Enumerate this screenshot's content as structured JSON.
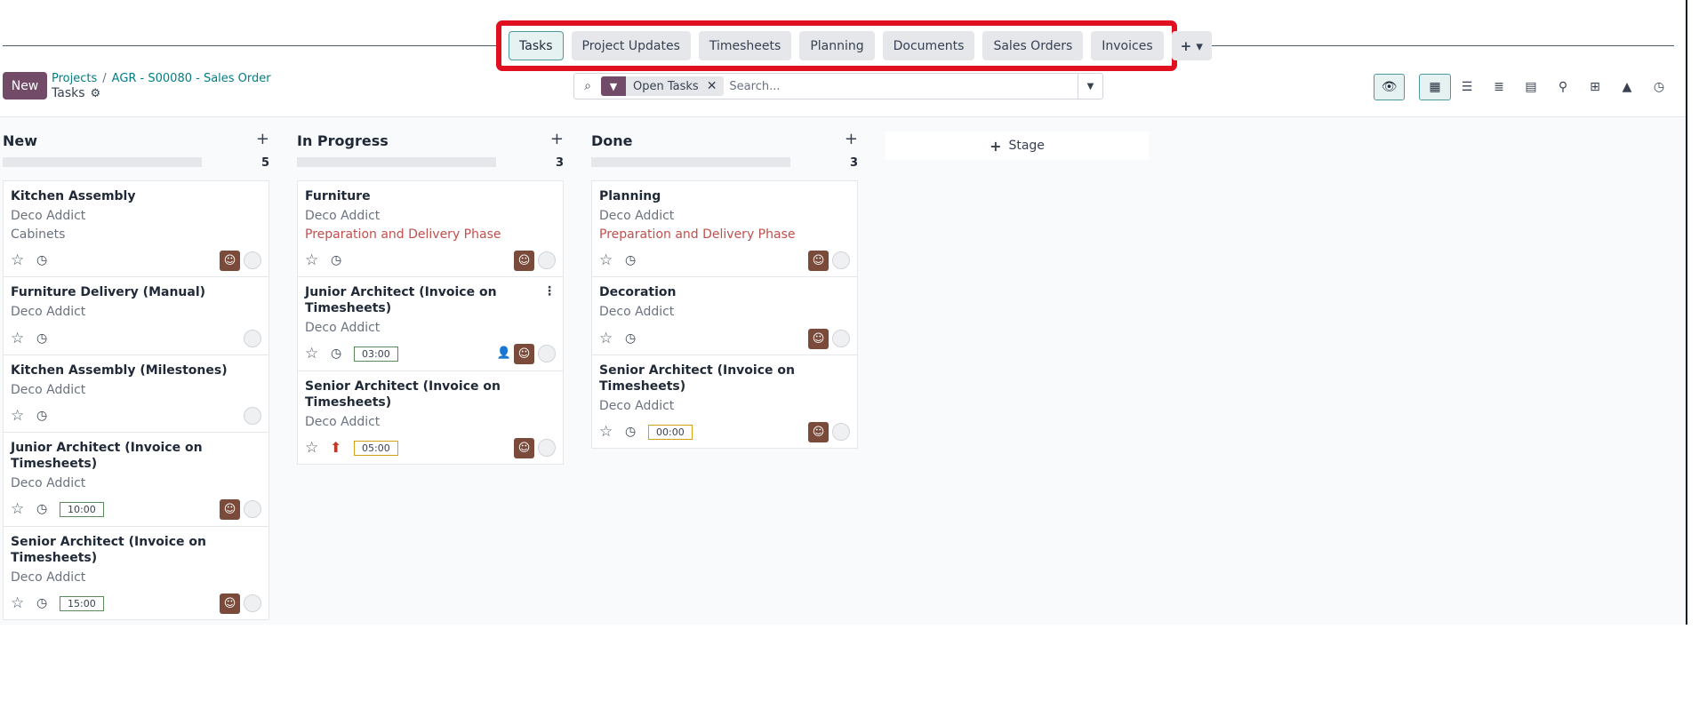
{
  "tabs": [
    {
      "label": "Tasks",
      "active": true
    },
    {
      "label": "Project Updates"
    },
    {
      "label": "Timesheets"
    },
    {
      "label": "Planning"
    },
    {
      "label": "Documents"
    },
    {
      "label": "Sales Orders"
    },
    {
      "label": "Invoices"
    }
  ],
  "tabs_more": "+ ▾",
  "control": {
    "new_label": "New",
    "breadcrumb_root": "Projects",
    "breadcrumb_separator": "/",
    "breadcrumb_project": "AGR - S00080 - Sales Order",
    "subtitle": "Tasks"
  },
  "search": {
    "facet_label": "Open Tasks",
    "placeholder": "Search..."
  },
  "columns": [
    {
      "title": "New",
      "count": "5",
      "cards": [
        {
          "title": "Kitchen Assembly",
          "customer": "Deco Addict",
          "tag": "Cabinets"
        },
        {
          "title": "Furniture Delivery (Manual)",
          "customer": "Deco Addict"
        },
        {
          "title": "Kitchen Assembly (Milestones)",
          "customer": "Deco Addict"
        },
        {
          "title": "Junior Architect (Invoice on Timesheets)",
          "customer": "Deco Addict",
          "hours": "10:00"
        },
        {
          "title": "Senior Architect (Invoice on Timesheets)",
          "customer": "Deco Addict",
          "hours": "15:00"
        }
      ]
    },
    {
      "title": "In Progress",
      "count": "3",
      "cards": [
        {
          "title": "Furniture",
          "customer": "Deco Addict",
          "milestone": "Preparation and Delivery Phase"
        },
        {
          "title": "Junior Architect (Invoice on Timesheets)",
          "customer": "Deco Addict",
          "hours": "03:00"
        },
        {
          "title": "Senior Architect (Invoice on Timesheets)",
          "customer": "Deco Addict",
          "hours": "05:00"
        }
      ]
    },
    {
      "title": "Done",
      "count": "3",
      "cards": [
        {
          "title": "Planning",
          "customer": "Deco Addict",
          "milestone": "Preparation and Delivery Phase"
        },
        {
          "title": "Decoration",
          "customer": "Deco Addict"
        },
        {
          "title": "Senior Architect (Invoice on Timesheets)",
          "customer": "Deco Addict",
          "hours": "00:00"
        }
      ]
    }
  ],
  "add_stage_label": "Stage",
  "colors": {
    "brand": "#714b67",
    "accent": "#017e84",
    "milestone": "#c0504d",
    "highlight": "#e01020"
  }
}
